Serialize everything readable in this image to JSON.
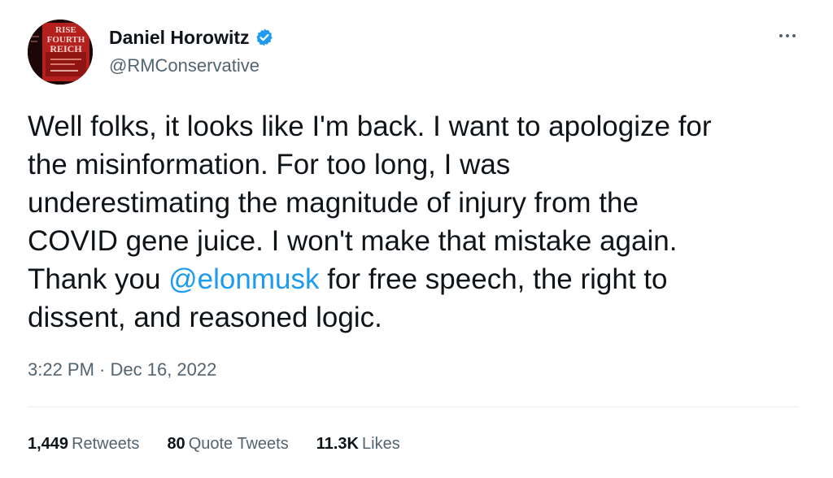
{
  "author": {
    "name": "Daniel Horowitz",
    "handle": "@RMConservative",
    "avatar_text": [
      "RISE",
      "FOURTH",
      "REICH"
    ]
  },
  "tweet": {
    "text_before": "Well folks, it looks like I'm back. I want to apologize for\nthe misinformation.  For too long, I was\nunderestimating the magnitude of injury from the\nCOVID gene juice. I won't make that mistake again.\nThank you ",
    "mention": "@elonmusk",
    "text_after": " for free speech, the right to\ndissent, and reasoned logic.",
    "timestamp": "3:22 PM · Dec 16, 2022"
  },
  "stats": {
    "retweets": {
      "count": "1,449",
      "label": "Retweets"
    },
    "quotes": {
      "count": "80",
      "label": "Quote Tweets"
    },
    "likes": {
      "count": "11.3K",
      "label": "Likes"
    }
  },
  "colors": {
    "accent": "#1d9bf0",
    "muted": "#536471",
    "text": "#0f1419"
  },
  "icons": {
    "verified": "verified-badge-icon",
    "more": "more-options-icon"
  }
}
